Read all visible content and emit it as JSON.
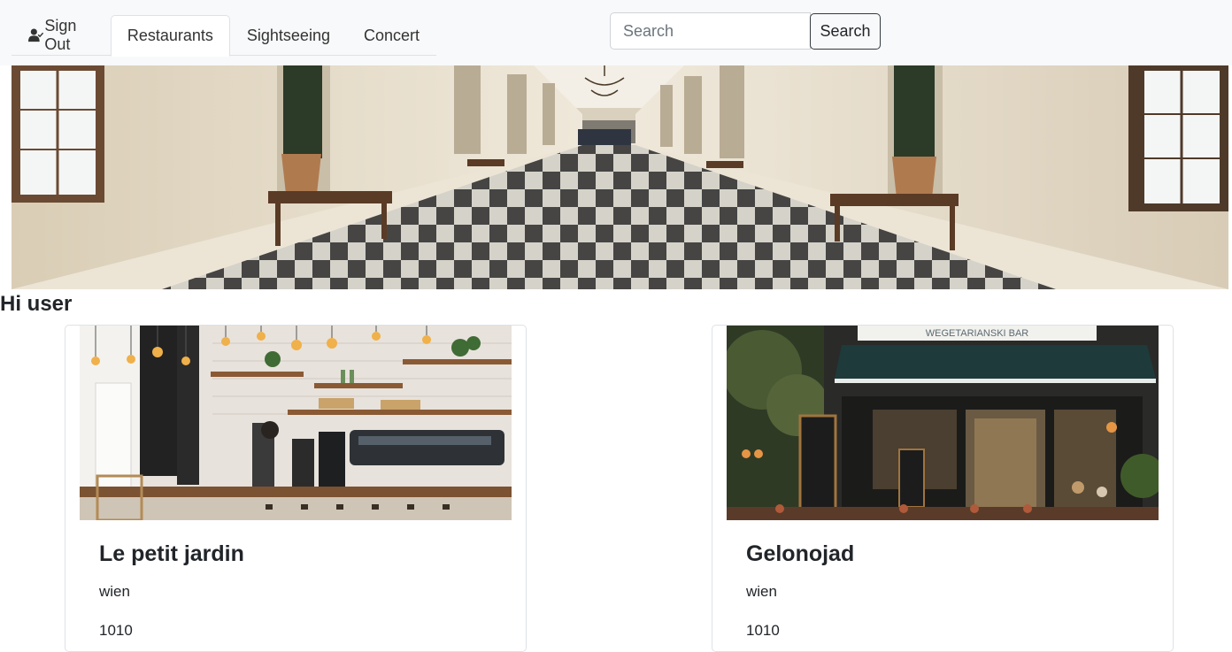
{
  "nav": {
    "tabs": [
      {
        "label": "Sign Out",
        "icon": "user-check-icon"
      },
      {
        "label": "Restaurants",
        "active": true
      },
      {
        "label": "Sightseeing"
      },
      {
        "label": "Concert"
      }
    ],
    "search": {
      "placeholder": "Search",
      "button_label": "Search"
    }
  },
  "hero": {
    "image": "palace-gallery-checkered-floor"
  },
  "greeting": "Hi user",
  "cards": [
    {
      "title": "Le petit jardin",
      "city": "wien",
      "zip": "1010",
      "image": "cafe-counter"
    },
    {
      "title": "Gelonojad",
      "city": "wien",
      "zip": "1010",
      "image": "restaurant-storefront",
      "sign_text": "WEGETARIANSKI BAR"
    }
  ],
  "colors": {
    "navbar_bg": "#f8f9fa",
    "border": "#dee2e6",
    "text": "#212529"
  }
}
